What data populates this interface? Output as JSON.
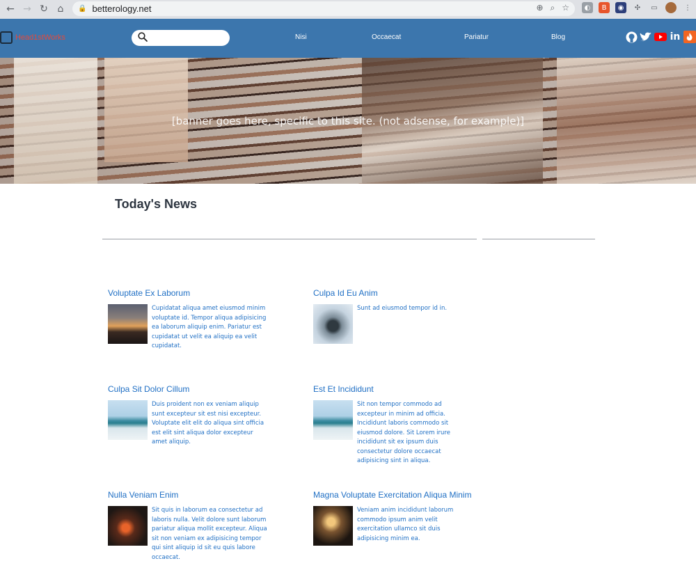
{
  "browser": {
    "url": "betterology.net"
  },
  "header": {
    "logo_text": "Head1stWorks",
    "search": {
      "placeholder": "",
      "value": ""
    },
    "nav": [
      "Nisi",
      "Occaecat",
      "Pariatur",
      "Blog"
    ],
    "socials": [
      "github-icon",
      "twitter-icon",
      "youtube-icon",
      "linkedin-icon",
      "feed-icon"
    ]
  },
  "banner": {
    "text": "[banner goes here, specific to this site. (not adsense, for example)]"
  },
  "main": {
    "title": "Today's News",
    "articles": [
      {
        "title": "Voluptate Ex Laborum",
        "excerpt": "Cupidatat aliqua amet eiusmod minim voluptate id. Tempor aliqua adipisicing ea laborum aliquip enim. Pariatur est cupidatat ut velit ea aliquip ea velit cupidatat.",
        "image": "sunset-thumbnail"
      },
      {
        "title": "Culpa Id Eu Anim",
        "excerpt": "Sunt ad eiusmod tempor id in.",
        "image": "rock-thumbnail"
      },
      {
        "title": "Culpa Sit Dolor Cillum",
        "excerpt": "Duis proident non ex veniam aliquip sunt excepteur sit est nisi excepteur. Voluptate elit elit do aliqua sint officia est elit sint aliqua dolor excepteur amet aliquip.",
        "image": "sea-thumbnail"
      },
      {
        "title": "Est Et Incididunt",
        "excerpt": "Sit non tempor commodo ad excepteur in minim ad officia. Incididunt laboris commodo sit eiusmod dolore. Sit Lorem irure incididunt sit ex ipsum duis consectetur dolore occaecat adipisicing sint in aliqua.",
        "image": "sea-thumbnail"
      },
      {
        "title": "Nulla Veniam Enim",
        "excerpt": "Sit quis in laborum ea consectetur ad laboris nulla. Velit dolore sunt laborum pariatur aliqua mollit excepteur. Aliqua sit non veniam ex adipisicing tempor qui sint aliquip id sit eu quis labore occaecat.",
        "image": "neon-star-thumbnail"
      },
      {
        "title": "Magna Voluptate Exercitation Aliqua Minim",
        "excerpt": "Veniam anim incididunt laborum commodo ipsum anim velit exercitation ullamco sit duis adipisicing minim ea.",
        "image": "hand-light-thumbnail"
      }
    ]
  },
  "colors": {
    "header_bg": "#3c76ad",
    "link_blue": "#1f6fc4",
    "logo_red": "#e34a3d"
  }
}
